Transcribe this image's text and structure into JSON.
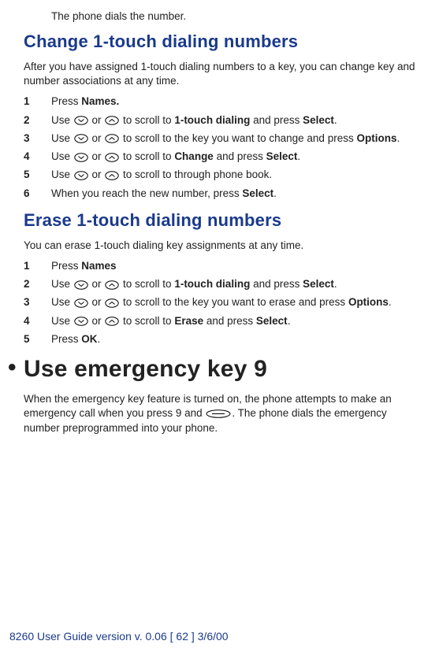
{
  "intro": "The phone dials the number.",
  "section1": {
    "title": "Change 1-touch dialing numbers",
    "desc": "After you have assigned 1-touch dialing numbers to a key, you can change key and number associations at any time.",
    "steps": [
      {
        "n": "1",
        "pre": "Press ",
        "b1": "Names.",
        "post": ""
      },
      {
        "n": "2",
        "pre": "Use ",
        "mid": " or ",
        "post1": " to scroll to ",
        "b1": "1-touch dialing",
        "post2": " and press ",
        "b2": "Select",
        "post3": "."
      },
      {
        "n": "3",
        "pre": "Use ",
        "mid": " or ",
        "post1": " to scroll to the key you want to change and press ",
        "b1": "Options",
        "post2": "."
      },
      {
        "n": "4",
        "pre": "Use ",
        "mid": " or ",
        "post1": " to scroll to ",
        "b1": "Change",
        "post2": " and press ",
        "b2": "Select",
        "post3": "."
      },
      {
        "n": "5",
        "pre": "Use ",
        "mid": " or ",
        "post1": " to scroll to through phone book."
      },
      {
        "n": "6",
        "pre": "When you reach the new number, press ",
        "b1": "Select",
        "post": "."
      }
    ]
  },
  "section2": {
    "title": "Erase 1-touch dialing numbers",
    "desc": "You can erase 1-touch dialing key assignments at any time.",
    "steps": [
      {
        "n": "1",
        "pre": "Press ",
        "b1": "Names"
      },
      {
        "n": "2",
        "pre": "Use ",
        "mid": " or ",
        "post1": " to scroll to ",
        "b1": "1-touch dialing",
        "post2": " and press ",
        "b2": "Select",
        "post3": "."
      },
      {
        "n": "3",
        "pre": "Use ",
        "mid": " or ",
        "post1": " to scroll to the key you want to erase and press ",
        "b1": "Options",
        "post2": "."
      },
      {
        "n": "4",
        "pre": "Use ",
        "mid": " or ",
        "post1": " to scroll to ",
        "b1": "Erase",
        "post2": " and press ",
        "b2": "Select",
        "post3": "."
      },
      {
        "n": "5",
        "pre": "Press ",
        "b1": "OK",
        "post": "."
      }
    ]
  },
  "big": {
    "bullet": "•",
    "title": "Use emergency key 9",
    "desc_pre": "When the emergency key feature is turned on, the phone attempts to make an emergency call when you press 9 and ",
    "desc_post": ". The phone dials the emergency number preprogrammed into your phone."
  },
  "footer": "8260 User Guide version v. 0.06 [ 62 ] 3/6/00"
}
